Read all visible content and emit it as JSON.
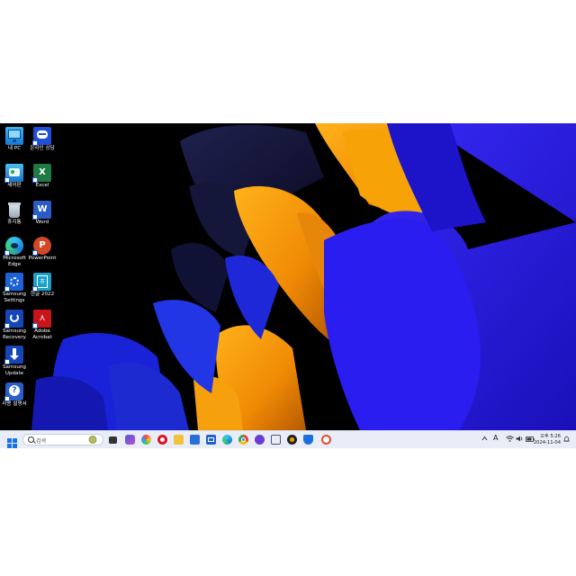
{
  "desktop": {
    "icons": [
      {
        "label": "내 PC",
        "icon": "monitor-icon"
      },
      {
        "label": "온라인 상담",
        "icon": "chat-bubble-icon"
      },
      {
        "label": "제어판",
        "icon": "control-panel-icon"
      },
      {
        "label": "Excel",
        "icon": "excel-icon"
      },
      {
        "label": "휴지통",
        "icon": "recycle-bin-icon"
      },
      {
        "label": "Word",
        "icon": "word-icon"
      },
      {
        "label": "Microsoft Edge",
        "icon": "edge-icon"
      },
      {
        "label": "PowerPoint",
        "icon": "powerpoint-icon"
      },
      {
        "label": "Samsung Settings",
        "icon": "gear-icon"
      },
      {
        "label": "한글 2022",
        "icon": "hangul-icon"
      },
      {
        "label": "Samsung Recovery",
        "icon": "recovery-icon"
      },
      {
        "label": "Adobe Acrobat",
        "icon": "acrobat-icon"
      },
      {
        "label": "Samsung Update",
        "icon": "update-icon"
      },
      {
        "label": "사용 설명서",
        "icon": "help-icon"
      }
    ]
  },
  "taskbar": {
    "search_placeholder": "검색",
    "apps": [
      "task-view-icon",
      "copilot-icon",
      "photos-icon",
      "app-q-icon",
      "file-explorer-icon",
      "microsoft-store-icon",
      "mail-icon",
      "edge-icon",
      "chrome-icon",
      "samsung-app-icon",
      "capture-icon",
      "music-icon",
      "security-icon",
      "remote-icon"
    ],
    "tray": {
      "ime": "A",
      "time": "오후 5:26",
      "date": "2024-11-04"
    }
  },
  "colors": {
    "taskbar_bg": "#e8edf7",
    "accent_blue": "#1e3ff0",
    "accent_orange": "#f5a00c"
  }
}
